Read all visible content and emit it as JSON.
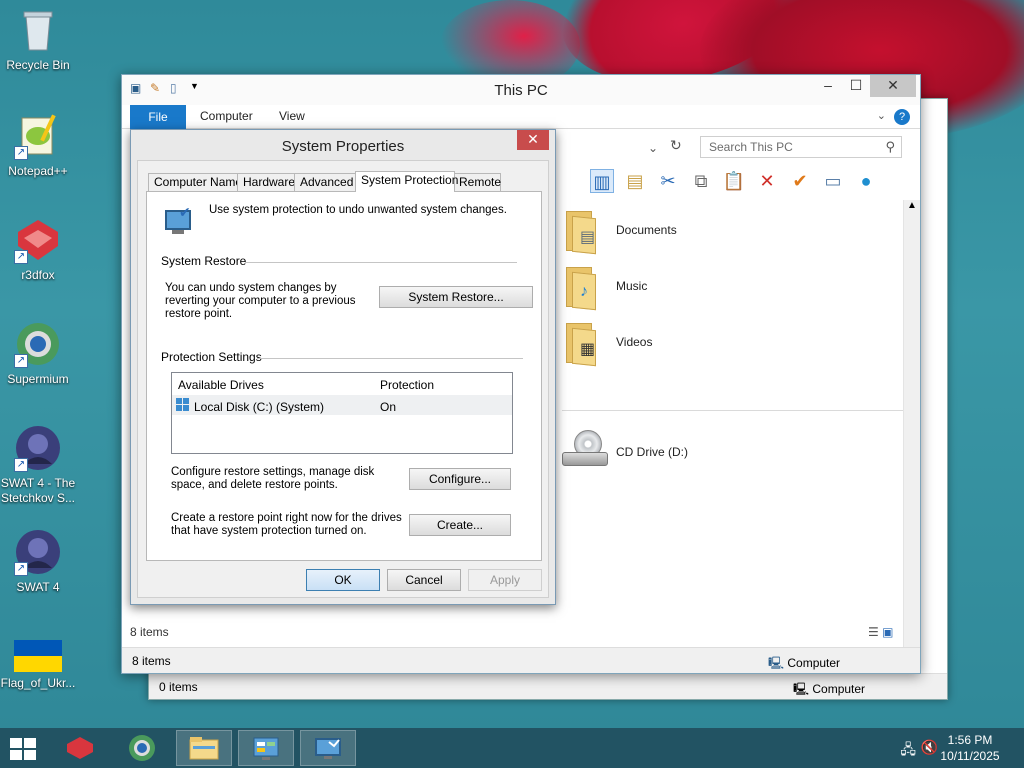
{
  "desktop": {
    "icons": [
      {
        "label": "Recycle Bin"
      },
      {
        "label": "Notepad++"
      },
      {
        "label": "r3dfox"
      },
      {
        "label": "Supermium"
      },
      {
        "label": "SWAT 4 - The Stetchkov S..."
      },
      {
        "label": "SWAT 4"
      },
      {
        "label": "Flag_of_Ukr..."
      }
    ]
  },
  "back_window": {
    "status_items": "0 items",
    "status_computer": "Computer"
  },
  "explorer": {
    "title": "This PC",
    "ribbon_tabs": {
      "file": "File",
      "computer": "Computer",
      "view": "View"
    },
    "search_placeholder": "Search This PC",
    "folders": [
      {
        "label": "Documents"
      },
      {
        "label": "Music"
      },
      {
        "label": "Videos"
      }
    ],
    "drive": {
      "label": "CD Drive (D:)"
    },
    "status_count": "8 items",
    "status_count2": "8 items",
    "status_computer": "Computer"
  },
  "dialog": {
    "title": "System Properties",
    "tabs": [
      "Computer Name",
      "Hardware",
      "Advanced",
      "System Protection",
      "Remote"
    ],
    "active_tab": "System Protection",
    "intro": "Use system protection to undo unwanted system changes.",
    "system_restore": {
      "group_label": "System Restore",
      "text": "You can undo system changes by reverting your computer to a previous restore point.",
      "button": "System Restore..."
    },
    "protection": {
      "group_label": "Protection Settings",
      "columns": [
        "Available Drives",
        "Protection"
      ],
      "rows": [
        {
          "drive": "Local Disk (C:) (System)",
          "protection": "On"
        }
      ],
      "configure_text": "Configure restore settings, manage disk space, and delete restore points.",
      "configure_button": "Configure...",
      "create_text": "Create a restore point right now for the drives that have system protection turned on.",
      "create_button": "Create..."
    },
    "buttons": {
      "ok": "OK",
      "cancel": "Cancel",
      "apply": "Apply"
    }
  },
  "taskbar": {
    "time": "1:56 PM",
    "date": "10/11/2025"
  }
}
